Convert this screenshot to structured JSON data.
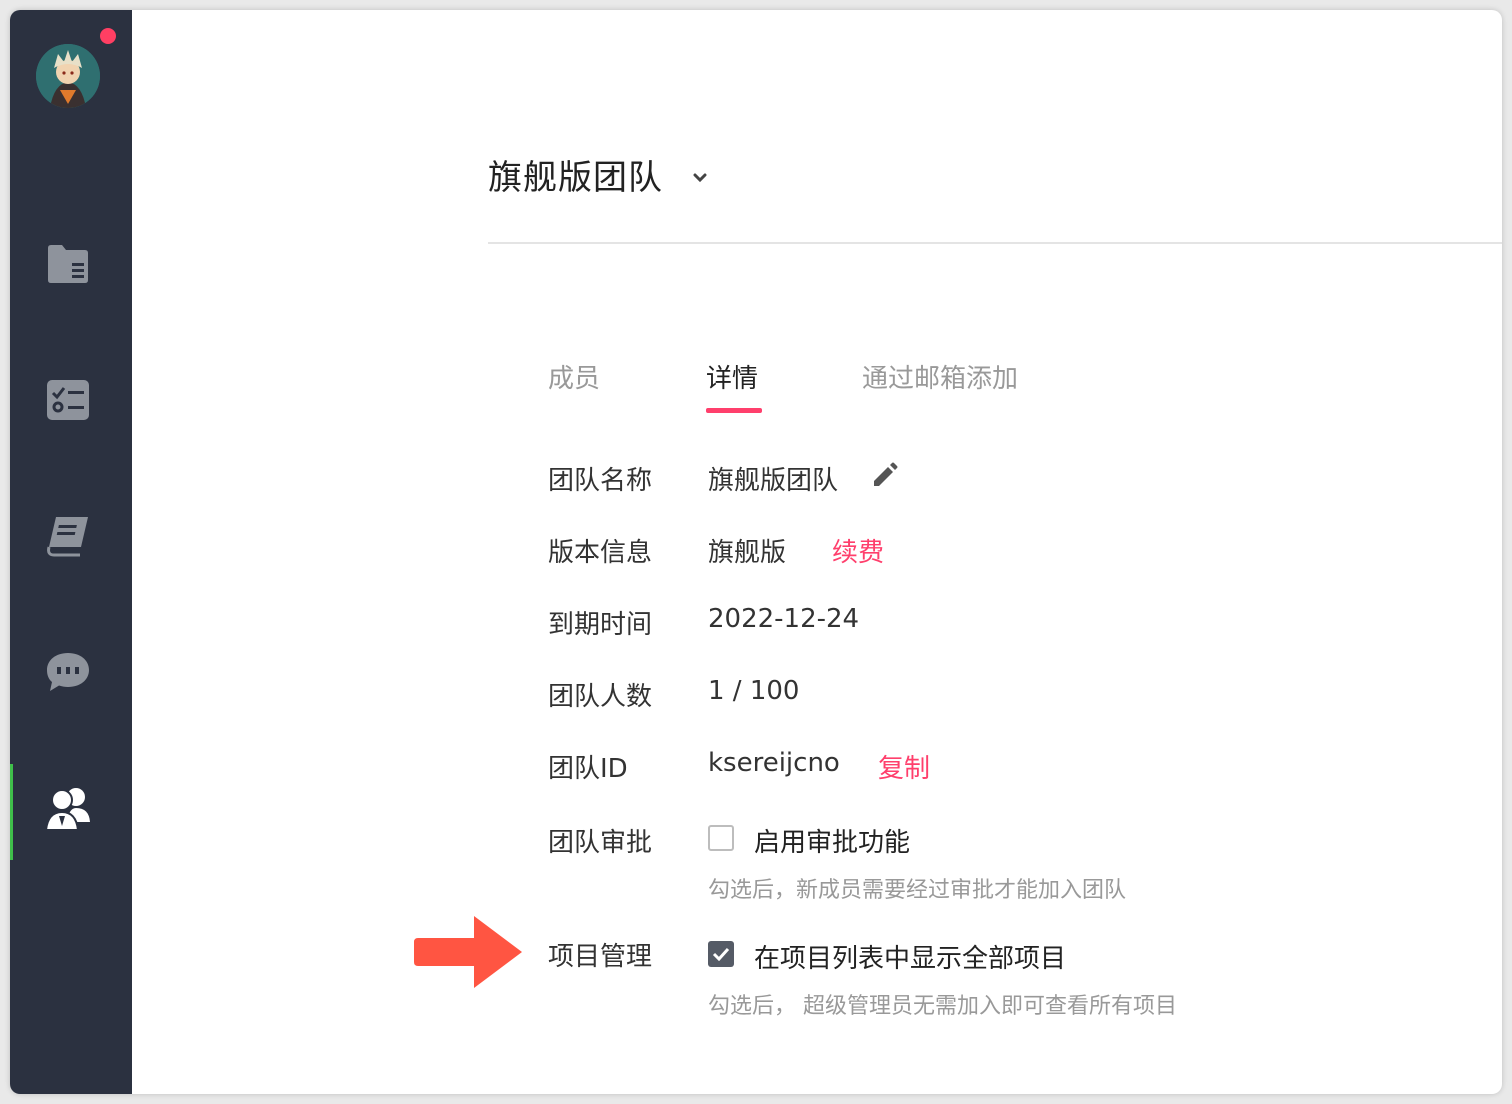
{
  "team_switcher": {
    "name": "旗舰版团队"
  },
  "tabs": [
    {
      "label": "成员"
    },
    {
      "label": "详情"
    },
    {
      "label": "通过邮箱添加"
    }
  ],
  "details": {
    "team_name": {
      "label": "团队名称",
      "value": "旗舰版团队"
    },
    "edition": {
      "label": "版本信息",
      "value": "旗舰版",
      "action": "续费"
    },
    "expiry": {
      "label": "到期时间",
      "value": "2022-12-24"
    },
    "members": {
      "label": "团队人数",
      "value": "1 / 100"
    },
    "team_id": {
      "label": "团队ID",
      "value": "ksereijcno",
      "action": "复制"
    },
    "approval": {
      "label": "团队审批",
      "checkbox_label": "启用审批功能",
      "checked": false,
      "hint": "勾选后，新成员需要经过审批才能加入团队"
    },
    "project_mgmt": {
      "label": "项目管理",
      "checkbox_label": "在项目列表中显示全部项目",
      "checked": true,
      "hint": "勾选后， 超级管理员无需加入即可查看所有项目"
    }
  },
  "colors": {
    "sidebar": "#2b3140",
    "accent": "#ff3f6c",
    "active_indicator": "#3fbf4a",
    "arrow": "#ff5542"
  },
  "icons": [
    "folder-icon",
    "checklist-icon",
    "book-icon",
    "chat-icon",
    "team-icon",
    "edit-icon",
    "chevron-down-icon",
    "check-icon"
  ]
}
